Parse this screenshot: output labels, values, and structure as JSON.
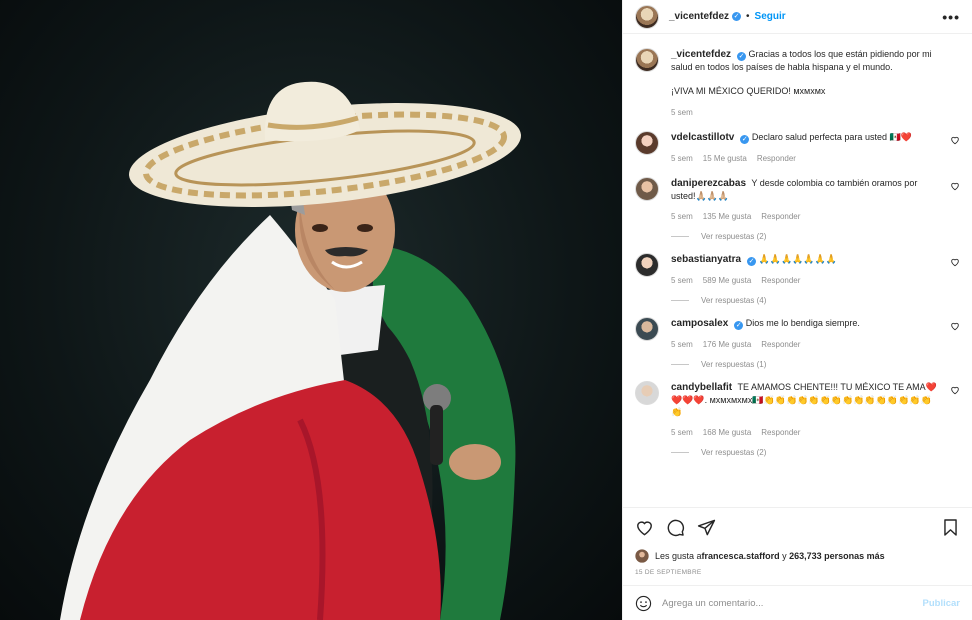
{
  "header": {
    "username": "_vicentefdez",
    "separator": "•",
    "follow_label": "Seguir",
    "more_label": "•••"
  },
  "caption": {
    "username": "_vicentefdez",
    "text": "Gracias a todos los que están pidiendo por mi salud en todos los países de habla hispana y el mundo.",
    "text2": "¡VIVA MI MÉXICO QUERIDO! ᴍxᴍxᴍx",
    "time": "5 sem"
  },
  "comments": [
    {
      "username": "vdelcastillotv",
      "verified": true,
      "text": "Declaro salud perfecta para usted 🇲🇽❤️",
      "time": "5 sem",
      "likes": "15 Me gusta",
      "reply": "Responder",
      "replies": null
    },
    {
      "username": "daniperezcabas",
      "verified": false,
      "text": "Y desde colombia co también oramos por usted!🙏🏼🙏🏼🙏🏼",
      "time": "5 sem",
      "likes": "135 Me gusta",
      "reply": "Responder",
      "replies": "Ver respuestas (2)"
    },
    {
      "username": "sebastianyatra",
      "verified": true,
      "text": "🙏🙏🙏🙏🙏🙏🙏",
      "time": "5 sem",
      "likes": "589 Me gusta",
      "reply": "Responder",
      "replies": "Ver respuestas (4)"
    },
    {
      "username": "camposalex",
      "verified": true,
      "text": "Dios me lo bendiga siempre.",
      "time": "5 sem",
      "likes": "176 Me gusta",
      "reply": "Responder",
      "replies": "Ver respuestas (1)"
    },
    {
      "username": "candybellafit",
      "verified": false,
      "text": "TE AMAMOS CHENTE!!! TU MÉXICO TE AMA❤️❤️❤️❤️. ᴍxᴍxᴍxᴍx🇲🇽👏👏👏👏👏👏👏👏👏👏👏👏👏👏👏👏",
      "time": "5 sem",
      "likes": "168 Me gusta",
      "reply": "Responder",
      "replies": "Ver respuestas (2)"
    }
  ],
  "likes_line": {
    "prefix": "Les gusta a ",
    "user": "francesca.stafford",
    "middle": " y ",
    "count": "263,733 personas más"
  },
  "date": "15 DE SEPTIEMBRE",
  "add_comment": {
    "placeholder": "Agrega un comentario...",
    "publish_label": "Publicar"
  },
  "colors": {
    "link_blue": "#0095f6",
    "muted": "#8e8e8e",
    "flag_green": "#1f7a3d",
    "flag_red": "#c8202f"
  },
  "icons": [
    "heart-icon",
    "comment-icon",
    "share-icon",
    "bookmark-icon",
    "emoji-icon",
    "verified-badge-icon",
    "more-options-icon"
  ]
}
